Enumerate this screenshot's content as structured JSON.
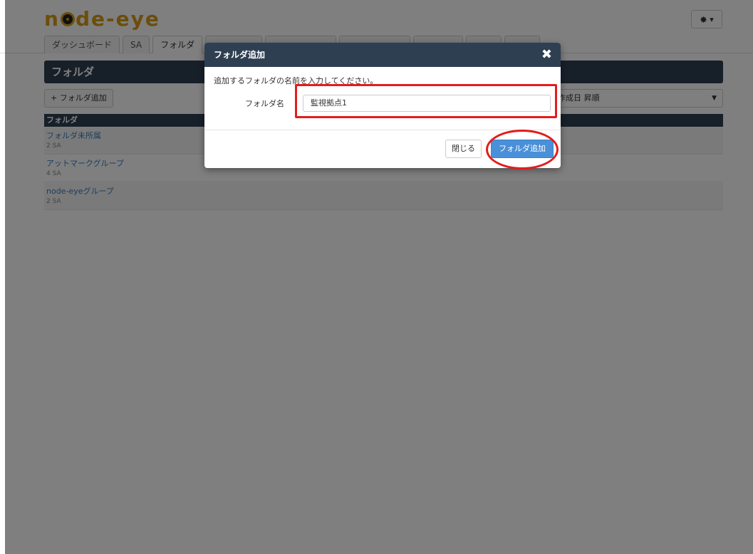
{
  "header": {
    "logo_prefix": "n",
    "logo_suffix": "de-eye",
    "settings_caret": "▾"
  },
  "tabs": [
    {
      "label": "ダッシュボード",
      "active": false
    },
    {
      "label": "SA",
      "active": false
    },
    {
      "label": "フォルダ",
      "active": true
    }
  ],
  "panel": {
    "title": "フォルダ",
    "add_button": "+ フォルダ追加",
    "sort_selected": "作成日 昇順",
    "table_header": "フォルダ"
  },
  "folders": [
    {
      "name": "フォルダ未所属",
      "count": "2 SA"
    },
    {
      "name": "アットマークグループ",
      "count": "4 SA"
    },
    {
      "name": "node-eyeグループ",
      "count": "2 SA"
    }
  ],
  "modal": {
    "title": "フォルダ追加",
    "close_icon": "✖",
    "instruction": "追加するフォルダの名前を入力してください。",
    "field_label": "フォルダ名",
    "field_value": "監視拠点1",
    "close_button": "閉じる",
    "submit_button": "フォルダ追加"
  },
  "colors": {
    "brand": "#d69d17",
    "header_bar": "#2f3f52",
    "primary_button": "#4a90d9",
    "annotation": "#e41c1c"
  }
}
